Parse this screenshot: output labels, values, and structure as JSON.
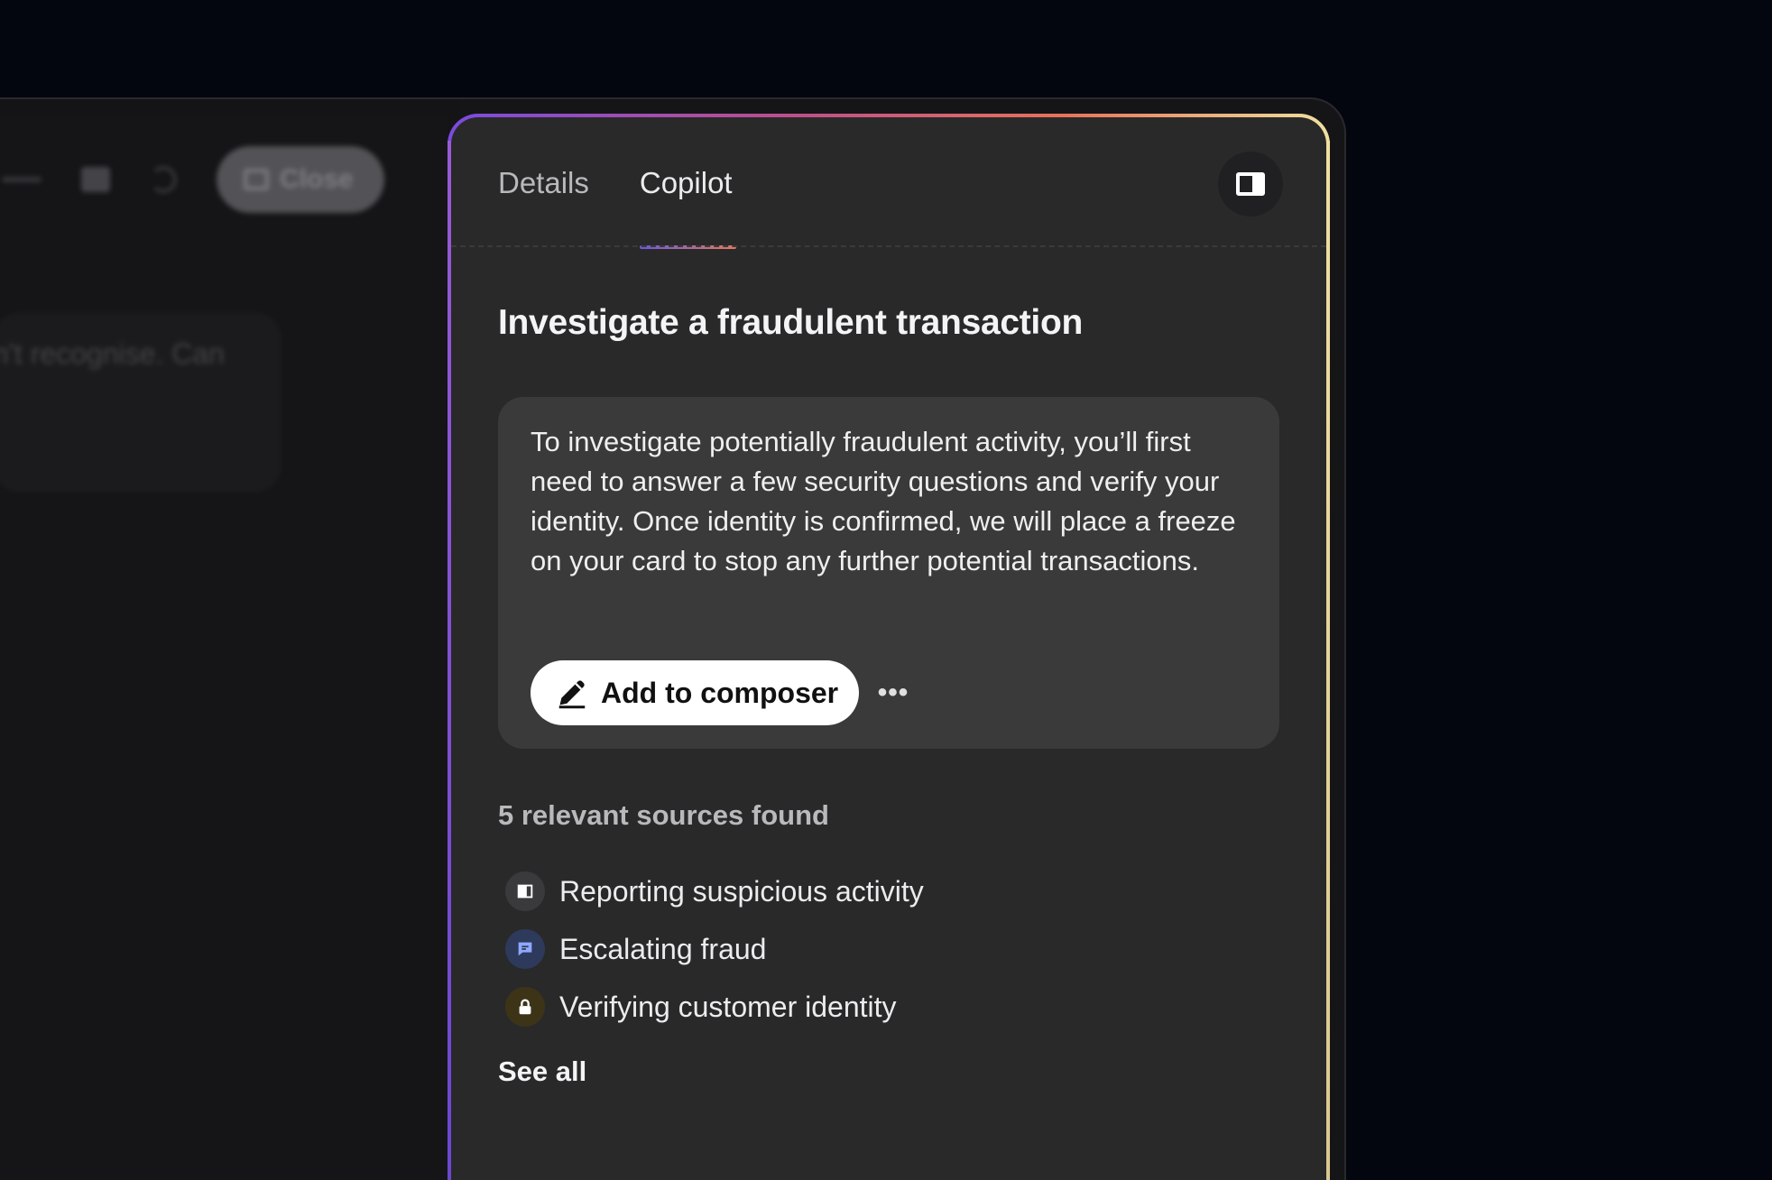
{
  "background_app": {
    "close_label": "Close",
    "bubble_text": "n't recognise. Can"
  },
  "copilot": {
    "tabs": [
      {
        "label": "Details",
        "active": false
      },
      {
        "label": "Copilot",
        "active": true
      }
    ],
    "panel_toggle_icon": "sidebar-toggle-icon",
    "answer": {
      "title": "Investigate a fraudulent transaction",
      "text": "To investigate potentially fraudulent activity, you’ll first need to answer a few security questions and verify your identity. Once identity is confirmed, we will place a freeze on your card to stop any further potential transactions.",
      "add_button_label": "Add to composer",
      "add_button_icon": "pencil-icon",
      "more_label": "•••"
    },
    "sources": {
      "heading": "5 relevant sources found",
      "items": [
        {
          "label": "Reporting suspicious activity",
          "icon": "book-icon",
          "icon_bg": "#3a3a3c",
          "icon_color": "#ffffff"
        },
        {
          "label": "Escalating fraud",
          "icon": "chat-icon",
          "icon_bg": "#2d3a5c",
          "icon_color": "#8fa8ff"
        },
        {
          "label": "Verifying customer identity",
          "icon": "lock-icon",
          "icon_bg": "#3d3418",
          "icon_color": "#ffffff"
        }
      ],
      "see_all_label": "See all"
    },
    "colors": {
      "panel_bg": "#292929",
      "card_bg": "#3a3a3b",
      "gradient_start": "#7a4be0",
      "gradient_end": "#f0e0a0"
    }
  }
}
